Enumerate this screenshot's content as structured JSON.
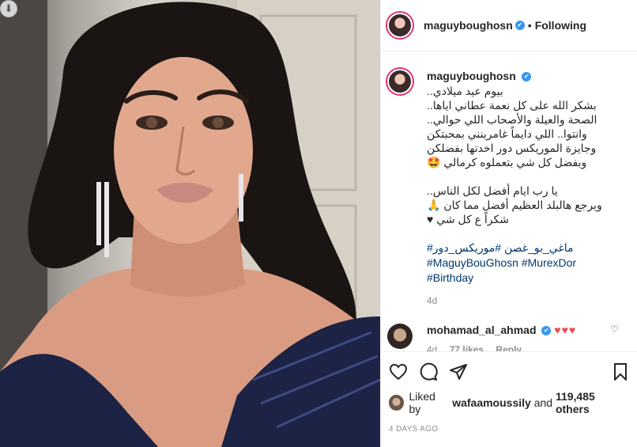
{
  "post": {
    "username": "maguyboughosn",
    "verified_mark": "✔",
    "dot": "•",
    "follow_status": "Following"
  },
  "caption": {
    "lines": [
      "بيوم عيد ميلادي..",
      "بشكر الله على كل نعمة عطاني اياها..",
      "الصحة والعيلة والأصحاب اللي حوالي..",
      "وانتوا.. اللي دايماً غامرينني بمحبتكن",
      "وجايزة الموريكس دور اخدتها بفضلكن",
      "وبفضل كل شي بتعملوه كرمالي 🤩"
    ],
    "lines2": [
      "يا رب ايام أفضل لكل الناس..",
      "ويرجع هالبلد العظيم أفضل مما كان 🙏",
      "شكراً ع كل شي ♥"
    ],
    "hashtag_line1": "#ماغي_بو_غصن #موريكس_دور",
    "hashtag_line2": "#MaguyBouGhosn #MurexDor",
    "hashtag_line3": "#Birthday",
    "time": "4d"
  },
  "comment": {
    "username": "mohamad_al_ahmad",
    "verified_mark": "✔",
    "text": "♥♥♥",
    "time": "4d",
    "likes": "77 likes",
    "reply": "Reply",
    "like_icon": "♡"
  },
  "actions": {
    "like_icon": "heart-outline-icon",
    "comment_icon": "comment-icon",
    "share_icon": "share-icon",
    "save_icon": "bookmark-icon"
  },
  "likes": {
    "prefix": "Liked by",
    "liker": "wafaamoussily",
    "and": "and",
    "count": "119,485 others"
  },
  "date": "4 DAYS AGO",
  "download_icon": "⬇"
}
